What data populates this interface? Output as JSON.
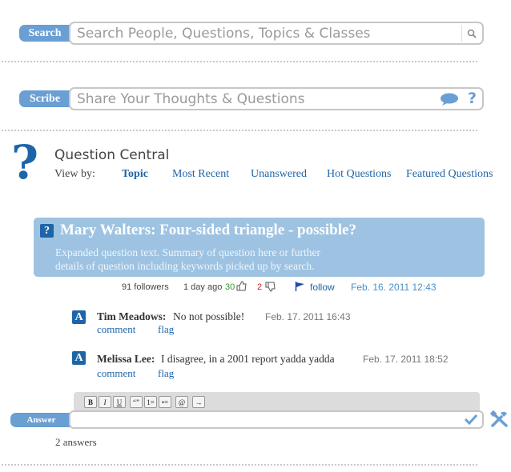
{
  "search": {
    "label": "Search",
    "placeholder": "Search People, Questions, Topics & Classes"
  },
  "scribe": {
    "label": "Scribe",
    "placeholder": "Share Your Thoughts & Questions",
    "help": "?"
  },
  "central": {
    "title": "Question Central",
    "view_by": "View by:",
    "tabs": [
      "Topic",
      "Most Recent",
      "Unanswered",
      "Hot Questions",
      "Featured Questions"
    ],
    "active_tab": "Topic"
  },
  "question": {
    "badge": "?",
    "title": "Mary Walters: Four-sided triangle - possible?",
    "body_line1": "Expanded question text. Summary of question here or further",
    "body_line2": "details of question including keywords picked up by search.",
    "followers": "91 followers",
    "age": "1 day ago",
    "up_votes": "30",
    "down_votes": "2",
    "follow": "follow",
    "date": "Feb. 16. 2011 12:43"
  },
  "answers": [
    {
      "badge": "A",
      "author": "Tim Meadows:",
      "text": "No not possible!",
      "date": "Feb. 17. 2011 16:43",
      "comment": "comment",
      "flag": "flag"
    },
    {
      "badge": "A",
      "author": "Melissa Lee:",
      "text": "I disagree, in a 2001 report yadda yadda",
      "date": "Feb. 17. 2011 18:52",
      "comment": "comment",
      "flag": "flag"
    }
  ],
  "editor": {
    "label": "Answer",
    "tools": [
      "B",
      "I",
      "U",
      "“”",
      "1=",
      "•=",
      "@",
      "→"
    ]
  },
  "answer_count": "2 answers",
  "colors": {
    "accent": "#6a9fd4",
    "link": "#1e64a8",
    "card": "#9ec3e2",
    "up": "#2e9a2e",
    "down": "#cc2222"
  },
  "icons": [
    "magnifier-icon",
    "speech-bubble-icon",
    "help-icon",
    "question-mark-icon",
    "thumb-up-icon",
    "thumb-down-icon",
    "flag-icon",
    "checkmark-icon",
    "tools-icon"
  ]
}
